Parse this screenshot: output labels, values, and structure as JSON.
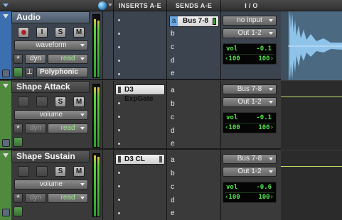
{
  "header": {
    "insert_title": "INSERTS A-E",
    "sends_title": "SENDS A-E",
    "io_title": "I / O"
  },
  "tracks": [
    {
      "name": "Audio",
      "rec": "",
      "input_mon": "I",
      "solo": "S",
      "mute": "M",
      "view": "waveform",
      "auto_label": "dyn",
      "auto_mode": "read",
      "voice": "Polyphonic",
      "inserts": [],
      "send_a": {
        "letter": "a",
        "name": "Bus 7-8"
      },
      "send_letters": [
        "b",
        "c",
        "d",
        "e"
      ],
      "input": "no input",
      "output": "Out 1-2",
      "vol_label": "vol",
      "vol_value": "-0.1",
      "pan_left": "‹100",
      "pan_right": "100›"
    },
    {
      "name": "Shape Attack",
      "solo": "S",
      "mute": "M",
      "view": "volume",
      "auto_label": "dyn",
      "auto_mode": "read",
      "inserts": [
        "D3 ExpGate"
      ],
      "send_letters": [
        "a",
        "b",
        "c",
        "d",
        "e"
      ],
      "input": "Bus 7-8",
      "output": "Out 1-2",
      "vol_label": "vol",
      "vol_value": "-0.1",
      "pan_left": "‹100",
      "pan_right": "100›"
    },
    {
      "name": "Shape Sustain",
      "solo": "S",
      "mute": "M",
      "view": "volume",
      "auto_label": "dyn",
      "auto_mode": "read",
      "inserts": [
        "D3 CL"
      ],
      "send_letters": [
        "a",
        "b",
        "c",
        "d",
        "e"
      ],
      "input": "Bus 7-8",
      "output": "Out 1-2",
      "vol_label": "vol",
      "vol_value": "-0.6",
      "pan_left": "‹100",
      "pan_right": "100›"
    }
  ],
  "colors": {
    "selected_name": "#6a7a8c",
    "waveform": "#8fc4ea",
    "volume_line": "#b9e06a",
    "meter_green": "#2fa02f"
  }
}
